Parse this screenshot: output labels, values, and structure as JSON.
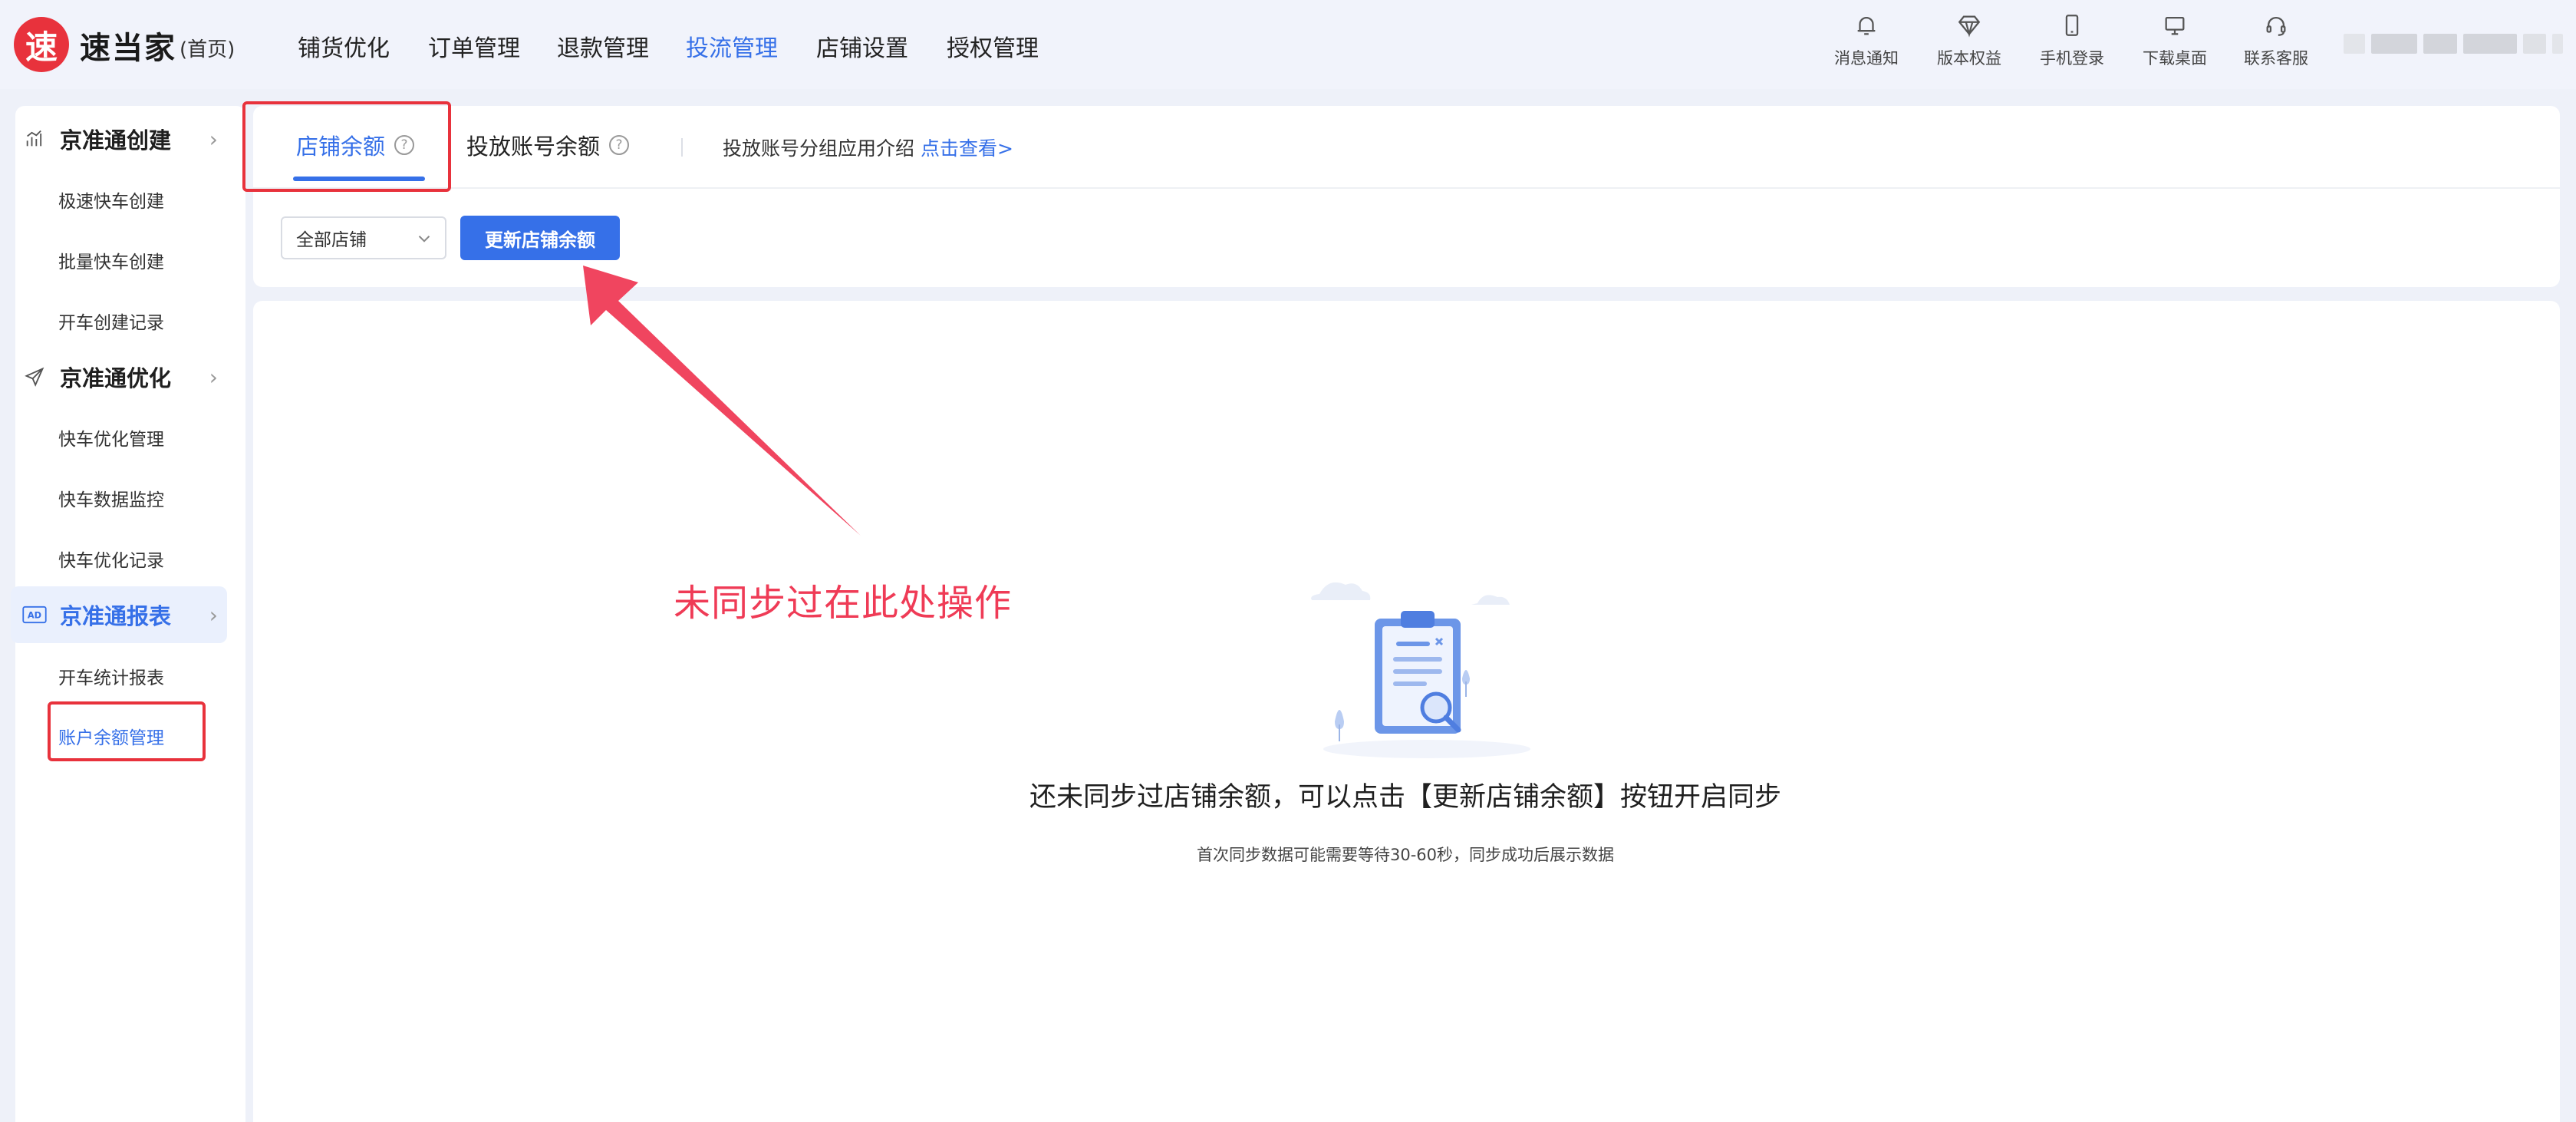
{
  "brand": {
    "logo_char": "速",
    "name": "速当家",
    "sub": "(首页)"
  },
  "nav": {
    "items": [
      {
        "label": "铺货优化"
      },
      {
        "label": "订单管理"
      },
      {
        "label": "退款管理"
      },
      {
        "label": "投流管理",
        "active": true
      },
      {
        "label": "店铺设置"
      },
      {
        "label": "授权管理"
      }
    ]
  },
  "tools": [
    {
      "label": "消息通知",
      "icon": "bell-icon"
    },
    {
      "label": "版本权益",
      "icon": "diamond-icon"
    },
    {
      "label": "手机登录",
      "icon": "phone-icon"
    },
    {
      "label": "下载桌面",
      "icon": "monitor-icon"
    },
    {
      "label": "联系客服",
      "icon": "headset-icon"
    }
  ],
  "sidebar": {
    "groups": [
      {
        "label": "京准通创建",
        "icon": "chart-icon",
        "items": [
          "极速快车创建",
          "批量快车创建",
          "开车创建记录"
        ]
      },
      {
        "label": "京准通优化",
        "icon": "send-icon",
        "items": [
          "快车优化管理",
          "快车数据监控",
          "快车优化记录"
        ]
      },
      {
        "label": "京准通报表",
        "icon": "ad-icon",
        "active": true,
        "items": [
          "开车统计报表",
          "账户余额管理"
        ]
      }
    ],
    "active_item": "账户余额管理"
  },
  "tabs": {
    "shop_balance": "店铺余额",
    "account_balance": "投放账号余额",
    "help_glyph": "?"
  },
  "intro": {
    "text": "投放账号分组应用介绍",
    "link": "点击查看>"
  },
  "filter": {
    "select_value": "全部店铺",
    "update_button": "更新店铺余额"
  },
  "empty": {
    "title": "还未同步过店铺余额，可以点击【更新店铺余额】按钮开启同步",
    "subtitle": "首次同步数据可能需要等待30-60秒，同步成功后展示数据"
  },
  "annotation": {
    "text": "未同步过在此处操作",
    "color": "#ef3b56"
  },
  "colors": {
    "accent": "#3670e8",
    "brand_red": "#e8323c",
    "highlight_box": "#e8323c"
  }
}
